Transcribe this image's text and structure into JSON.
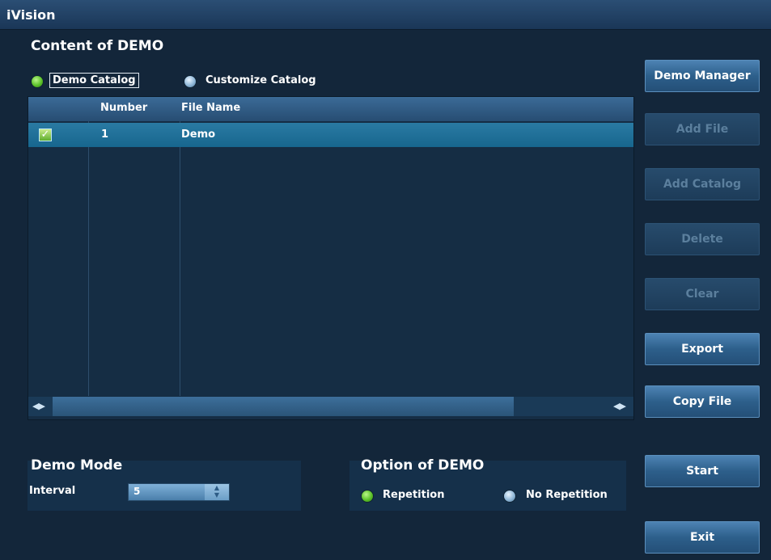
{
  "app": {
    "title": "iVision"
  },
  "content": {
    "section_title": "Content of DEMO",
    "catalog_options": [
      {
        "label": "Demo Catalog",
        "selected": true
      },
      {
        "label": "Customize Catalog",
        "selected": false
      }
    ],
    "table": {
      "headers": [
        "",
        "Number",
        "File Name"
      ],
      "rows": [
        {
          "checked": true,
          "number": "1",
          "file_name": "Demo"
        }
      ]
    }
  },
  "side_buttons": [
    {
      "label": "Demo Manager",
      "enabled": true
    },
    {
      "label": "Add File",
      "enabled": false
    },
    {
      "label": "Add Catalog",
      "enabled": false
    },
    {
      "label": "Delete",
      "enabled": false
    },
    {
      "label": "Clear",
      "enabled": false
    },
    {
      "label": "Export",
      "enabled": true
    },
    {
      "label": "Copy File",
      "enabled": true
    },
    {
      "label": "Start",
      "enabled": true
    },
    {
      "label": "Exit",
      "enabled": true
    }
  ],
  "demo_mode": {
    "title": "Demo Mode",
    "interval_label": "Interval",
    "interval_value": "5"
  },
  "option": {
    "title": "Option of DEMO",
    "choices": [
      {
        "label": "Repetition",
        "selected": true
      },
      {
        "label": "No Repetition",
        "selected": false
      }
    ]
  },
  "colors": {
    "background": "#13263a",
    "selected_row": "#1f6f98",
    "radio_on": "#5cc22a",
    "button_active": "#2d5f8b"
  }
}
